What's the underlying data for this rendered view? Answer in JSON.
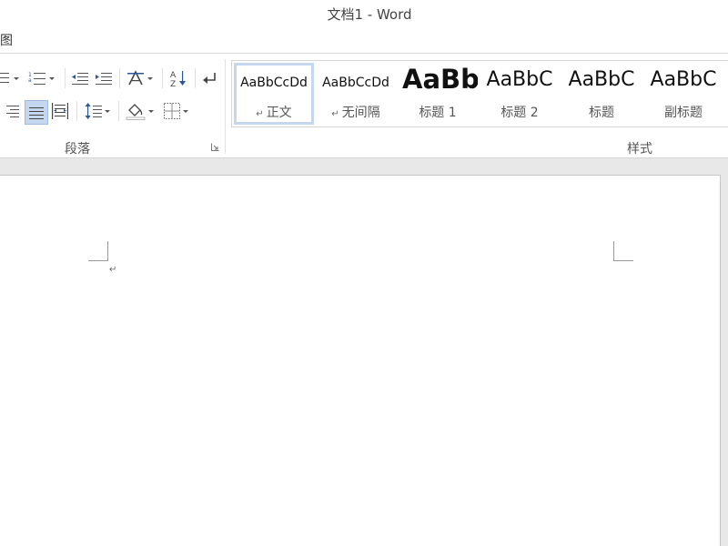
{
  "window": {
    "title": "文档1 - Word"
  },
  "menu": {
    "partial_tab": "图"
  },
  "ribbon": {
    "paragraph_group": {
      "label": "段落",
      "buttons": [
        {
          "name": "bullets",
          "icon": "bullet-list-icon"
        },
        {
          "name": "numbering",
          "icon": "numbered-list-icon"
        },
        {
          "name": "decrease-indent",
          "icon": "decrease-indent-icon"
        },
        {
          "name": "increase-indent",
          "icon": "increase-indent-icon"
        },
        {
          "name": "asian-layout",
          "icon": "asian-layout-icon"
        },
        {
          "name": "sort",
          "icon": "sort-az-icon"
        },
        {
          "name": "show-marks",
          "icon": "paragraph-mark-icon"
        },
        {
          "name": "align-right",
          "icon": "align-right-icon"
        },
        {
          "name": "justify",
          "icon": "justify-icon",
          "active": true
        },
        {
          "name": "distributed",
          "icon": "distributed-icon"
        },
        {
          "name": "line-spacing",
          "icon": "line-spacing-icon"
        },
        {
          "name": "shading",
          "icon": "shading-icon"
        },
        {
          "name": "borders",
          "icon": "borders-icon"
        }
      ]
    },
    "styles_group": {
      "label": "样式",
      "items": [
        {
          "preview": "AaBbCcDd",
          "name": "正文",
          "para_mark": "↵",
          "selected": true
        },
        {
          "preview": "AaBbCcDd",
          "name": "无间隔",
          "para_mark": "↵"
        },
        {
          "preview": "AaBb",
          "name": "标题 1"
        },
        {
          "preview": "AaBbC",
          "name": "标题 2"
        },
        {
          "preview": "AaBbC",
          "name": "标题"
        },
        {
          "preview": "AaBbC",
          "name": "副标题"
        }
      ]
    }
  },
  "document": {
    "paragraph_mark": "↵"
  },
  "colors": {
    "active_button": "#c5d7ef",
    "accent_blue": "#2b579a",
    "page_background": "#e8e8e8"
  }
}
